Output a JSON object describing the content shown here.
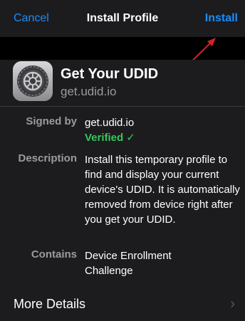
{
  "nav": {
    "cancel_label": "Cancel",
    "title": "Install Profile",
    "install_label": "Install"
  },
  "profile": {
    "name": "Get Your UDID",
    "host": "get.udid.io",
    "icon": "settings-gear-icon"
  },
  "details": {
    "signed_by_label": "Signed by",
    "signed_by_value": "get.udid.io",
    "verified_label": "Verified",
    "verified_icon": "✓",
    "description_label": "Description",
    "description_value": "Install this temporary profile to find and display your current device's UDID. It is automatically removed from device right after you get your UDID.",
    "contains_label": "Contains",
    "contains_value": "Device Enrollment Challenge"
  },
  "more": {
    "label": "More Details",
    "chevron": "›"
  },
  "colors": {
    "accent": "#1a8cff",
    "verified": "#34c759",
    "annotation_arrow": "#d0242a"
  }
}
